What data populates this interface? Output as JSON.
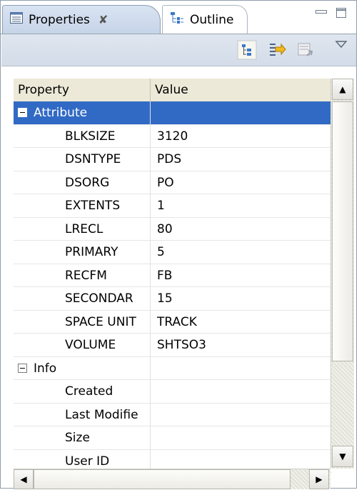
{
  "tabs": [
    {
      "label": "Properties",
      "icon": "properties-icon",
      "active": true
    },
    {
      "label": "Outline",
      "icon": "outline-icon",
      "active": false
    }
  ],
  "tab_close_glyph": "✘",
  "view_controls": {
    "minimize_icon": "minimize-icon",
    "maximize_icon": "maximize-icon"
  },
  "toolbar": {
    "icons": [
      "show-categories-icon",
      "show-advanced-properties-icon",
      "restore-default-icon",
      "view-menu-icon"
    ]
  },
  "table": {
    "headers": {
      "property": "Property",
      "value": "Value"
    },
    "categories": [
      {
        "label": "Attribute",
        "selected": true,
        "rows": [
          {
            "property": "BLKSIZE",
            "value": "3120"
          },
          {
            "property": "DSNTYPE",
            "value": "PDS"
          },
          {
            "property": "DSORG",
            "value": "PO"
          },
          {
            "property": "EXTENTS",
            "value": "1"
          },
          {
            "property": "LRECL",
            "value": "80"
          },
          {
            "property": "PRIMARY",
            "value": "5"
          },
          {
            "property": "RECFM",
            "value": "FB"
          },
          {
            "property": "SECONDAR",
            "value": "15"
          },
          {
            "property": "SPACE UNIT",
            "value": "TRACK"
          },
          {
            "property": "VOLUME",
            "value": "SHTSO3"
          }
        ]
      },
      {
        "label": "Info",
        "selected": false,
        "rows": [
          {
            "property": "Created",
            "value": ""
          },
          {
            "property": "Last Modifie",
            "value": ""
          },
          {
            "property": "Size",
            "value": ""
          },
          {
            "property": "User ID",
            "value": ""
          }
        ]
      }
    ]
  },
  "colors": {
    "selection": "#316ac5",
    "tab_active": "#d9e4f2"
  }
}
